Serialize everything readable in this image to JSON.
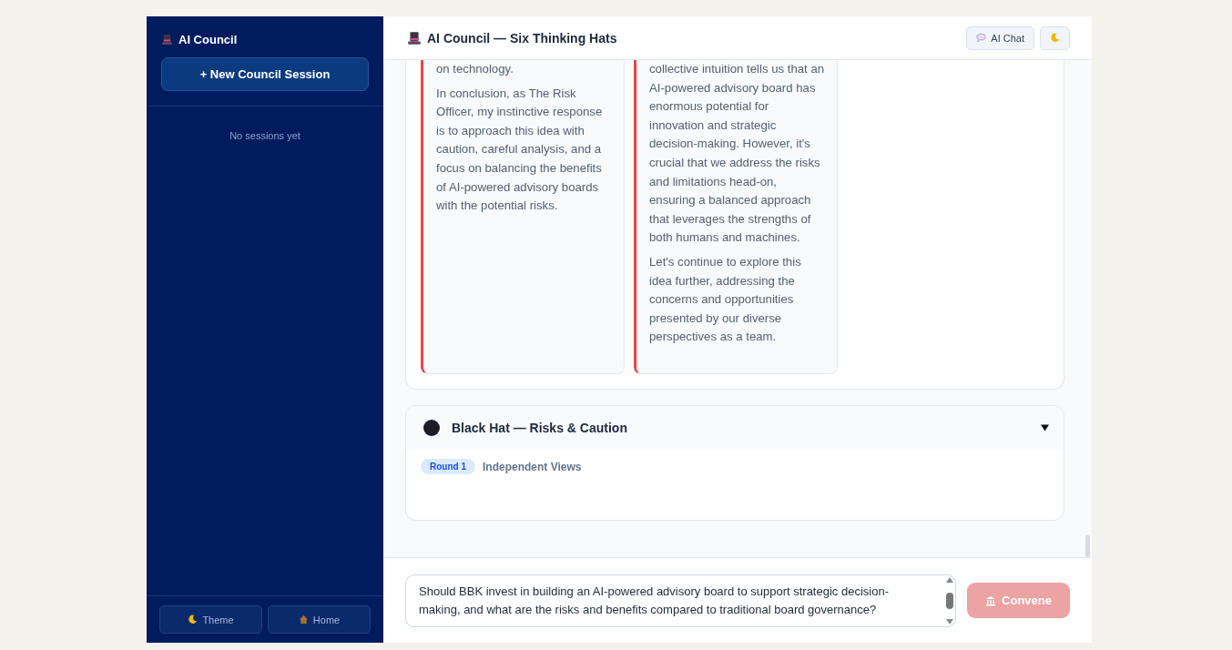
{
  "sidebar": {
    "title": "AI Council",
    "new_session_button": "+ New Council Session",
    "empty_message": "No sessions yet",
    "footer_buttons": [
      {
        "label": "Theme",
        "kind": "theme"
      },
      {
        "label": "Home",
        "kind": "home"
      }
    ]
  },
  "header": {
    "title": "AI Council — Six Thinking Hats",
    "buttons": [
      {
        "label": "AI Chat",
        "kind": "chat"
      },
      {
        "kind": "theme"
      }
    ]
  },
  "responses": [
    {
      "color": "#ef4444",
      "paragraphs": [
        "on technology.",
        "In conclusion, as The Risk Officer, my instinctive response is to approach this idea with caution, careful analysis, and a focus on balancing the benefits of AI-powered advisory boards with the potential risks."
      ]
    },
    {
      "color": "#ef4444",
      "paragraphs": [
        "collective intuition tells us that an AI-powered advisory board has enormous potential for innovation and strategic decision-making. However, it's crucial that we address the risks and limitations head-on, ensuring a balanced approach that leverages the strengths of both humans and machines.",
        "Let's continue to explore this idea further, addressing the concerns and opportunities presented by our diverse perspectives as a team."
      ]
    }
  ],
  "hat_section": {
    "title": "Black Hat — Risks & Caution",
    "color": "#1f1b24",
    "expanded": true,
    "round_badge": "Round 1",
    "round_label": "Independent Views"
  },
  "composer": {
    "value": "Should BBK invest in building an AI-powered advisory board to support strategic decision-making, and what are the risks and benefits compared to traditional board governance?",
    "button": "Convene",
    "button_disabled": true
  }
}
